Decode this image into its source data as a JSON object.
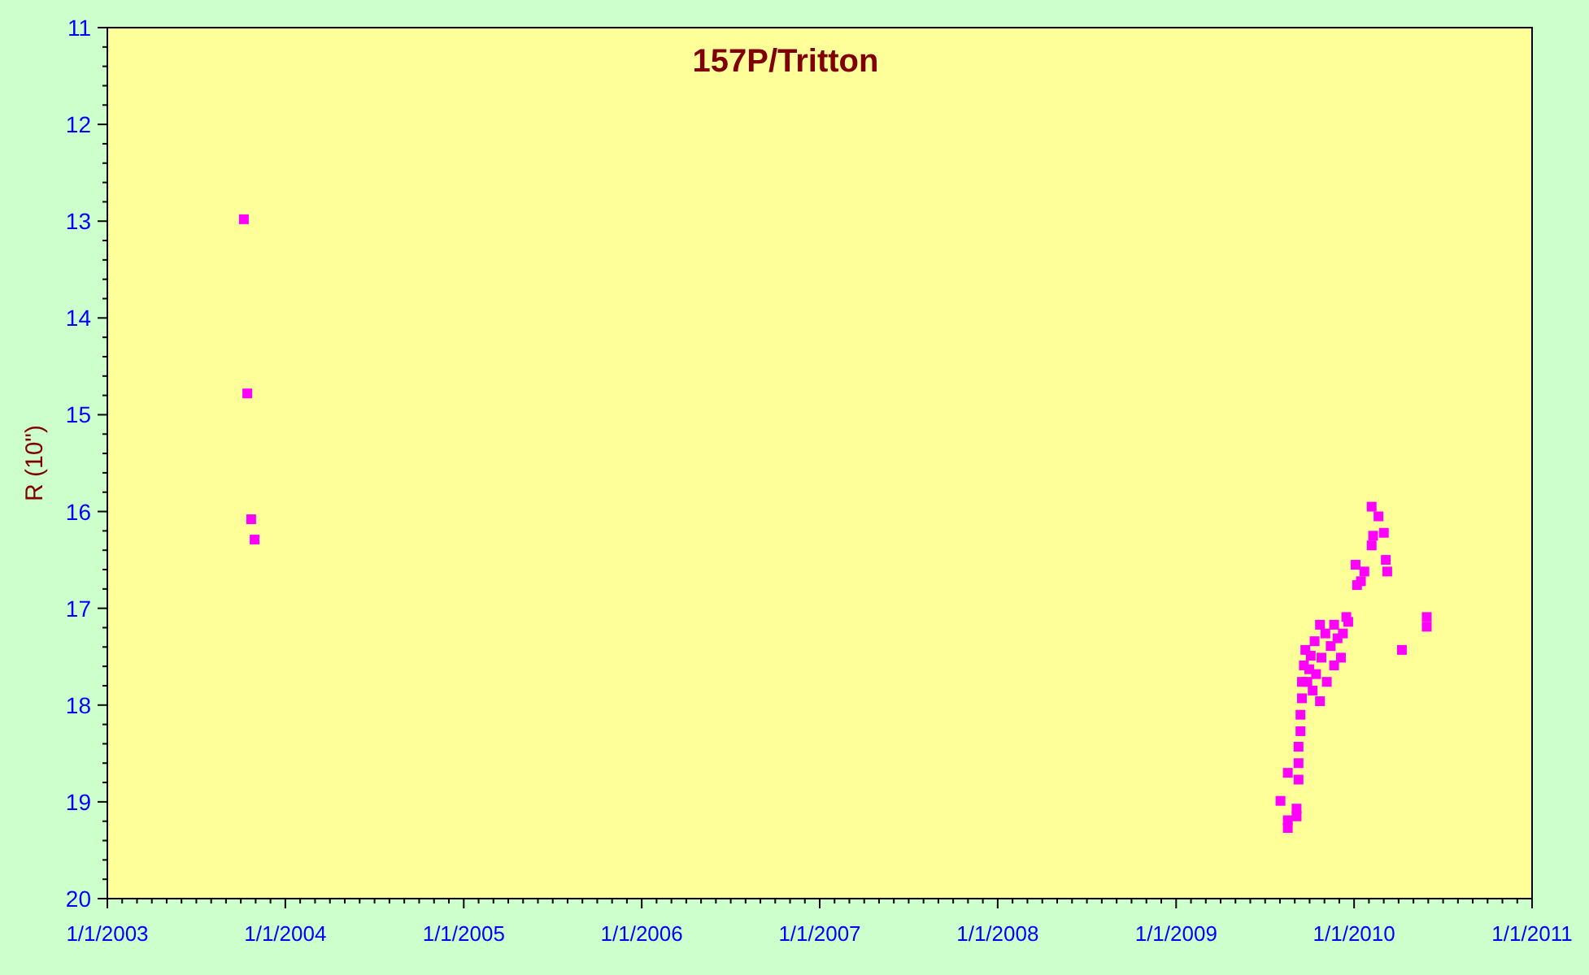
{
  "chart": {
    "chart_data": {
      "type": "scatter",
      "title": "157P/Tritton",
      "ylabel": "R (10\")",
      "x": [
        "2003-10-08",
        "2003-10-15",
        "2003-10-23",
        "2003-10-30",
        "2009-08-03",
        "2009-08-18",
        "2009-08-18",
        "2009-08-18",
        "2009-09-05",
        "2009-09-05",
        "2009-09-09",
        "2009-09-09",
        "2009-09-09",
        "2009-09-13",
        "2009-09-13",
        "2009-09-16",
        "2009-09-16",
        "2009-09-20",
        "2009-09-23",
        "2009-09-27",
        "2009-10-01",
        "2009-10-04",
        "2009-10-08",
        "2009-10-12",
        "2009-10-15",
        "2009-10-23",
        "2009-10-23",
        "2009-10-26",
        "2009-11-03",
        "2009-11-06",
        "2009-11-14",
        "2009-11-21",
        "2009-11-21",
        "2009-11-28",
        "2009-12-05",
        "2009-12-09",
        "2009-12-16",
        "2009-12-20",
        "2010-01-04",
        "2010-01-15",
        "2010-01-07",
        "2010-01-22",
        "2010-02-06",
        "2010-02-09",
        "2010-02-06",
        "2010-02-20",
        "2010-03-03",
        "2010-03-07",
        "2010-03-10",
        "2010-04-09",
        "2010-05-30",
        "2010-05-30"
      ],
      "series": [
        {
          "color": "#ff00ff",
          "values": [
            12.98,
            14.78,
            16.08,
            16.29,
            18.99,
            18.7,
            19.19,
            19.27,
            19.07,
            19.15,
            18.77,
            18.6,
            18.43,
            18.27,
            18.1,
            17.93,
            17.76,
            17.59,
            17.43,
            17.76,
            17.63,
            17.49,
            17.85,
            17.34,
            17.68,
            17.17,
            17.96,
            17.51,
            17.26,
            17.76,
            17.39,
            17.17,
            17.59,
            17.31,
            17.51,
            17.26,
            17.09,
            17.14,
            16.55,
            16.72,
            16.76,
            16.62,
            15.95,
            16.25,
            16.35,
            16.05,
            16.22,
            16.5,
            16.62,
            17.43,
            17.09,
            17.19
          ]
        }
      ],
      "xlim": [
        "2003-01-01",
        "2011-01-01"
      ],
      "ylim": [
        20,
        11
      ],
      "xticks": [
        {
          "value": "2003-01-01",
          "label": "1/1/2003"
        },
        {
          "value": "2004-01-01",
          "label": "1/1/2004"
        },
        {
          "value": "2005-01-01",
          "label": "1/1/2005"
        },
        {
          "value": "2006-01-01",
          "label": "1/1/2006"
        },
        {
          "value": "2007-01-01",
          "label": "1/1/2007"
        },
        {
          "value": "2008-01-01",
          "label": "1/1/2008"
        },
        {
          "value": "2009-01-01",
          "label": "1/1/2009"
        },
        {
          "value": "2010-01-01",
          "label": "1/1/2010"
        },
        {
          "value": "2011-01-01",
          "label": "1/1/2011"
        }
      ],
      "yticks": [
        11,
        12,
        13,
        14,
        15,
        16,
        17,
        18,
        19,
        20
      ]
    }
  }
}
